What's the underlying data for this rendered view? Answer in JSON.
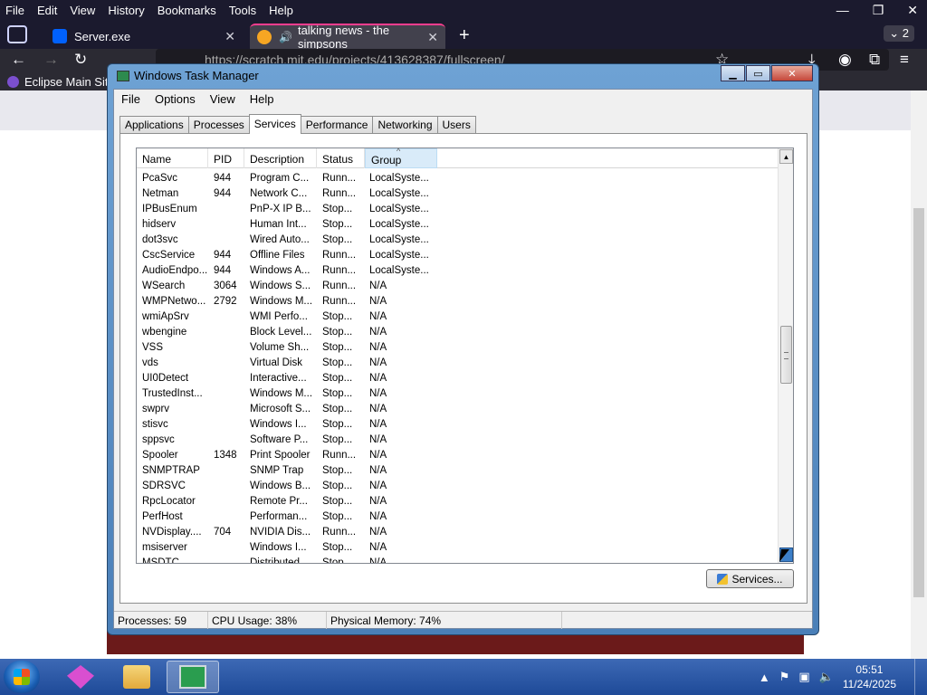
{
  "browser": {
    "menu": [
      "File",
      "Edit",
      "View",
      "History",
      "Bookmarks",
      "Tools",
      "Help"
    ],
    "window_controls": [
      "—",
      "❐",
      "✕"
    ],
    "tabs": [
      {
        "title": "Server.exe",
        "favicon": "dropbox-icon"
      },
      {
        "title": "talking news - the simpsons",
        "favicon": "scratch-icon",
        "audio": "speaker-icon"
      }
    ],
    "tab_count": "2",
    "url": "https://scratch.mit.edu/projects/413628387/fullscreen/",
    "bookmark": "Eclipse Main Site"
  },
  "taskmanager": {
    "title": "Windows Task Manager",
    "menu": [
      "File",
      "Options",
      "View",
      "Help"
    ],
    "tabs": [
      "Applications",
      "Processes",
      "Services",
      "Performance",
      "Networking",
      "Users"
    ],
    "active_tab": "Services",
    "columns": [
      "Name",
      "PID",
      "Description",
      "Status",
      "Group"
    ],
    "sorted_column": "Group",
    "rows": [
      [
        "PcaSvc",
        "944",
        "Program C...",
        "Runn...",
        "LocalSyste..."
      ],
      [
        "Netman",
        "944",
        "Network C...",
        "Runn...",
        "LocalSyste..."
      ],
      [
        "IPBusEnum",
        "",
        "PnP-X IP B...",
        "Stop...",
        "LocalSyste..."
      ],
      [
        "hidserv",
        "",
        "Human Int...",
        "Stop...",
        "LocalSyste..."
      ],
      [
        "dot3svc",
        "",
        "Wired Auto...",
        "Stop...",
        "LocalSyste..."
      ],
      [
        "CscService",
        "944",
        "Offline Files",
        "Runn...",
        "LocalSyste..."
      ],
      [
        "AudioEndpo...",
        "944",
        "Windows A...",
        "Runn...",
        "LocalSyste..."
      ],
      [
        "WSearch",
        "3064",
        "Windows S...",
        "Runn...",
        "N/A"
      ],
      [
        "WMPNetwo...",
        "2792",
        "Windows M...",
        "Runn...",
        "N/A"
      ],
      [
        "wmiApSrv",
        "",
        "WMI Perfo...",
        "Stop...",
        "N/A"
      ],
      [
        "wbengine",
        "",
        "Block Level...",
        "Stop...",
        "N/A"
      ],
      [
        "VSS",
        "",
        "Volume Sh...",
        "Stop...",
        "N/A"
      ],
      [
        "vds",
        "",
        "Virtual Disk",
        "Stop...",
        "N/A"
      ],
      [
        "UI0Detect",
        "",
        "Interactive...",
        "Stop...",
        "N/A"
      ],
      [
        "TrustedInst...",
        "",
        "Windows M...",
        "Stop...",
        "N/A"
      ],
      [
        "swprv",
        "",
        "Microsoft S...",
        "Stop...",
        "N/A"
      ],
      [
        "stisvc",
        "",
        "Windows I...",
        "Stop...",
        "N/A"
      ],
      [
        "sppsvc",
        "",
        "Software P...",
        "Stop...",
        "N/A"
      ],
      [
        "Spooler",
        "1348",
        "Print Spooler",
        "Runn...",
        "N/A"
      ],
      [
        "SNMPTRAP",
        "",
        "SNMP Trap",
        "Stop...",
        "N/A"
      ],
      [
        "SDRSVC",
        "",
        "Windows B...",
        "Stop...",
        "N/A"
      ],
      [
        "RpcLocator",
        "",
        "Remote Pr...",
        "Stop...",
        "N/A"
      ],
      [
        "PerfHost",
        "",
        "Performan...",
        "Stop...",
        "N/A"
      ],
      [
        "NVDisplay....",
        "704",
        "NVIDIA Dis...",
        "Runn...",
        "N/A"
      ],
      [
        "msiserver",
        "",
        "Windows I...",
        "Stop...",
        "N/A"
      ],
      [
        "MSDTC",
        "",
        "Distributed...",
        "Stop...",
        "N/A"
      ]
    ],
    "services_button": "Services...",
    "status": {
      "processes": "Processes: 59",
      "cpu": "CPU Usage: 38%",
      "memory": "Physical Memory: 74%"
    }
  },
  "taskbar": {
    "apps": [
      "purple-app-icon",
      "folder-icon",
      "task-manager-icon"
    ],
    "time": "05:51",
    "date": "11/24/2025"
  }
}
